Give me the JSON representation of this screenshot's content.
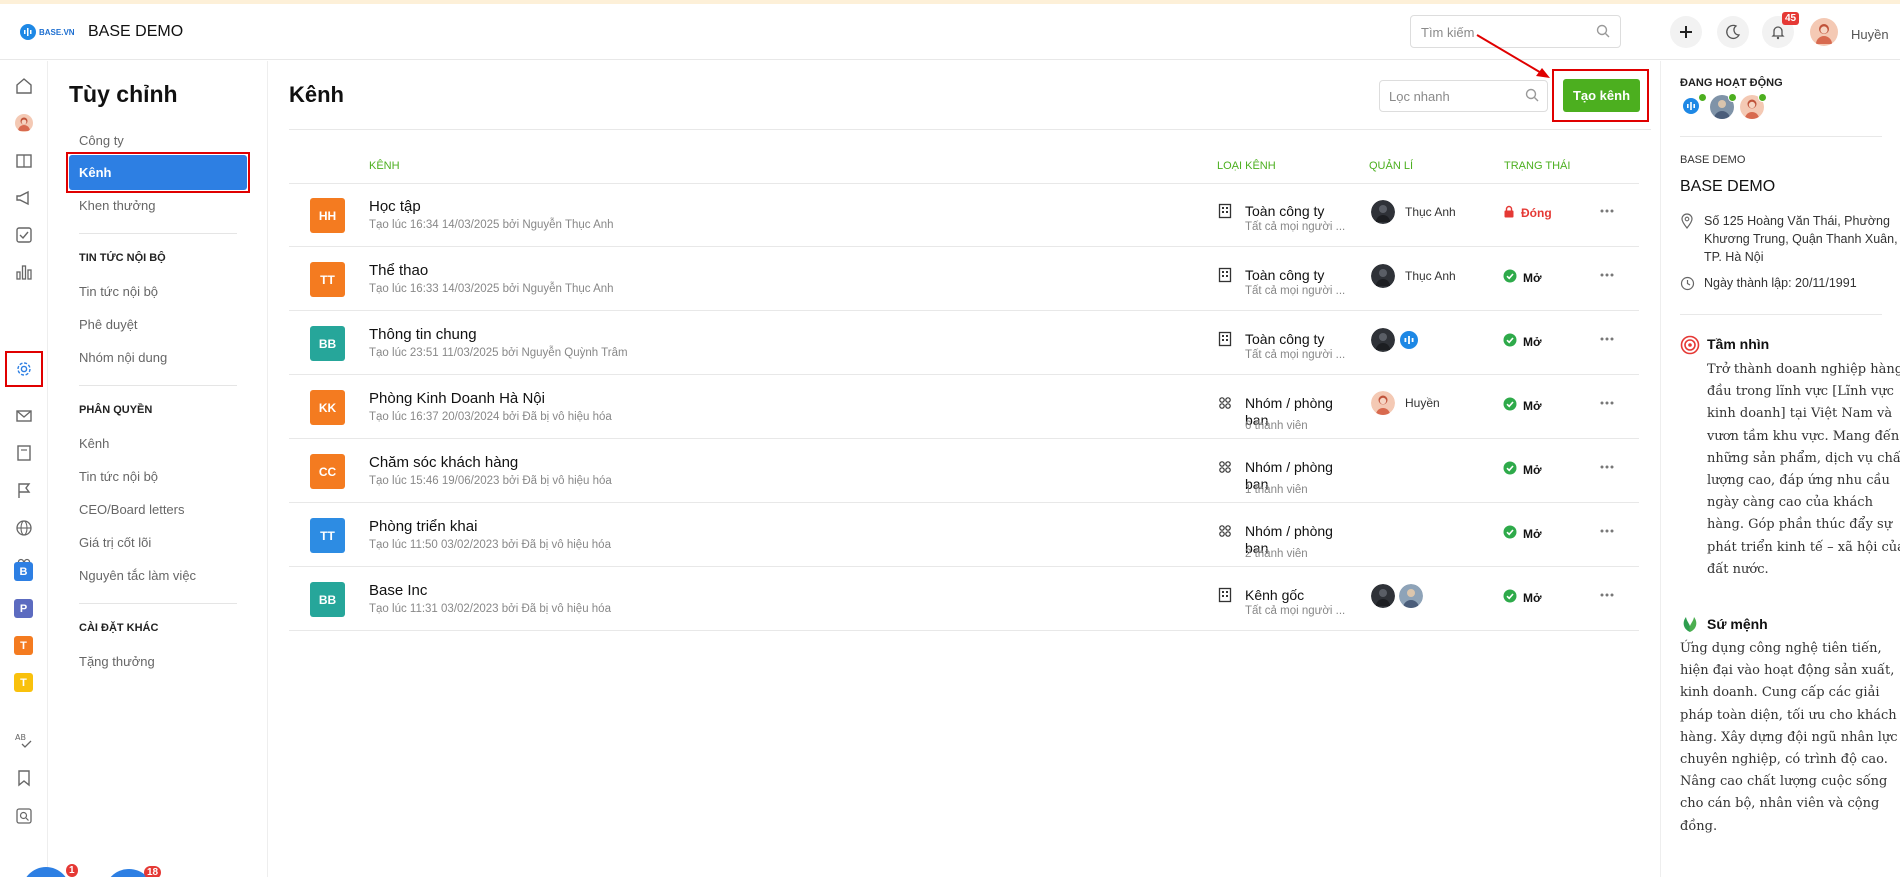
{
  "header": {
    "logo_text": "BASE.VN",
    "company": "BASE DEMO",
    "search_placeholder": "Tìm kiếm",
    "notification_count": "45",
    "user_name": "Huyền"
  },
  "rail": {
    "letters": [
      {
        "label": "B",
        "color": "#2d7fe3"
      },
      {
        "label": "P",
        "color": "#5c6bc0"
      },
      {
        "label": "T",
        "color": "#f47b20"
      },
      {
        "label": "T",
        "color": "#f9c10c"
      }
    ],
    "bottom_badges": [
      "1",
      "18"
    ]
  },
  "settings_nav": {
    "title": "Tùy chỉnh",
    "items_top": [
      "Công ty",
      "Kênh",
      "Khen thưởng"
    ],
    "active": "Kênh",
    "sections": [
      {
        "title": "TIN TỨC NỘI BỘ",
        "items": [
          "Tin tức nội bộ",
          "Phê duyệt",
          "Nhóm nội dung"
        ]
      },
      {
        "title": "PHÂN QUYỀN",
        "items": [
          "Kênh",
          "Tin tức nội bộ",
          "CEO/Board letters",
          "Giá trị cốt lõi",
          "Nguyên tắc làm việc"
        ]
      },
      {
        "title": "CÀI ĐẶT KHÁC",
        "items": [
          "Tặng thưởng"
        ]
      }
    ]
  },
  "main": {
    "title": "Kênh",
    "filter_placeholder": "Lọc nhanh",
    "create_label": "Tạo kênh",
    "columns": {
      "channel": "KÊNH",
      "type": "LOẠI KÊNH",
      "manager": "QUẢN LÍ",
      "status": "TRẠNG THÁI"
    },
    "rows": [
      {
        "initials": "HH",
        "color": "#f47b20",
        "name": "Học tập",
        "sub": "Tạo lúc 16:34 14/03/2025 bởi Nguyễn Thục Anh",
        "type_icon": "building-icon",
        "type": "Toàn công ty",
        "type_sub": "Tất cả mọi người ...",
        "manager": "Thục Anh",
        "status": "Đóng",
        "status_kind": "closed"
      },
      {
        "initials": "TT",
        "color": "#f47b20",
        "name": "Thể thao",
        "sub": "Tạo lúc 16:33 14/03/2025 bởi Nguyễn Thục Anh",
        "type_icon": "building-icon",
        "type": "Toàn công ty",
        "type_sub": "Tất cả mọi người ...",
        "manager": "Thục Anh",
        "status": "Mở",
        "status_kind": "open"
      },
      {
        "initials": "BB",
        "color": "#26a69a",
        "name": "Thông tin chung",
        "sub": "Tạo lúc 23:51 11/03/2025 bởi Nguyễn Quỳnh Trâm",
        "type_icon": "building-icon",
        "type": "Toàn công ty",
        "type_sub": "Tất cả mọi người ...",
        "manager": "",
        "status": "Mở",
        "status_kind": "open"
      },
      {
        "initials": "KK",
        "color": "#f47b20",
        "name": "Phòng Kinh Doanh Hà Nội",
        "sub": "Tạo lúc 16:37 20/03/2024 bởi Đã bị vô hiệu hóa",
        "type_icon": "group-icon",
        "type": "Nhóm / phòng ban",
        "type_sub": "6 thành viên",
        "manager": "Huyền",
        "status": "Mở",
        "status_kind": "open"
      },
      {
        "initials": "CC",
        "color": "#f47b20",
        "name": "Chăm sóc khách hàng",
        "sub": "Tạo lúc 15:46 19/06/2023 bởi Đã bị vô hiệu hóa",
        "type_icon": "group-icon",
        "type": "Nhóm / phòng ban",
        "type_sub": "1 thành viên",
        "manager": "",
        "status": "Mở",
        "status_kind": "open"
      },
      {
        "initials": "TT",
        "color": "#2d8ce3",
        "name": "Phòng triển khai",
        "sub": "Tạo lúc 11:50 03/02/2023 bởi Đã bị vô hiệu hóa",
        "type_icon": "group-icon",
        "type": "Nhóm / phòng ban",
        "type_sub": "2 thành viên",
        "manager": "",
        "status": "Mở",
        "status_kind": "open"
      },
      {
        "initials": "BB",
        "color": "#26a69a",
        "name": "Base Inc",
        "sub": "Tạo lúc 11:31 03/02/2023 bởi Đã bị vô hiệu hóa",
        "type_icon": "building-icon",
        "type": "Kênh gốc",
        "type_sub": "Tất cả mọi người ...",
        "manager": "",
        "status": "Mở",
        "status_kind": "open"
      }
    ]
  },
  "right_panel": {
    "active_title": "ĐANG HOẠT ĐỘNG",
    "company_label": "BASE DEMO",
    "company_name": "BASE DEMO",
    "address": "Số 125 Hoàng Văn Thái, Phường Khương Trung, Quận Thanh Xuân, TP. Hà Nội",
    "founded": "Ngày thành lập: 20/11/1991",
    "vision_title": "Tầm nhìn",
    "vision_text": "Trở thành doanh nghiệp hàng đầu trong lĩnh vực [Lĩnh vực kinh doanh] tại Việt Nam và vươn tầm khu vực. Mang đến những sản phẩm, dịch vụ chất lượng cao, đáp ứng nhu cầu ngày càng cao của khách hàng. Góp phần thúc đẩy sự phát triển kinh tế – xã hội của đất nước.",
    "mission_title": "Sứ mệnh",
    "mission_text": "Ứng dụng công nghệ tiên tiến, hiện đại vào hoạt động sản xuất, kinh doanh. Cung cấp các giải pháp toàn diện, tối ưu cho khách hàng. Xây dựng đội ngũ nhân lực chuyên nghiệp, có trình độ cao. Nâng cao chất lượng cuộc sống cho cán bộ, nhân viên và cộng đồng."
  },
  "colors": {
    "accent_green": "#4caf1f",
    "active_blue": "#2d7fe3",
    "highlight_red": "#e00000"
  }
}
